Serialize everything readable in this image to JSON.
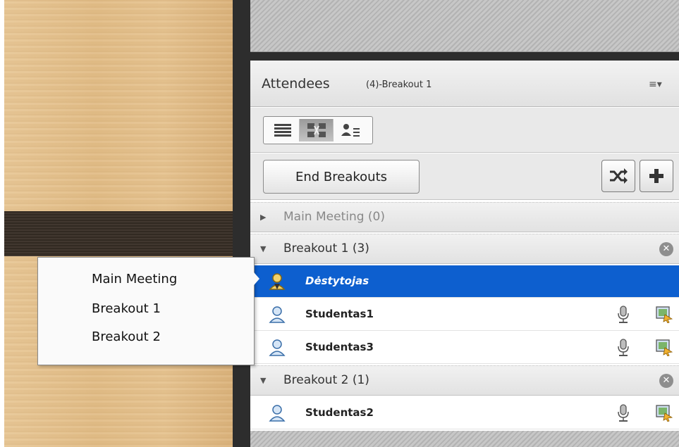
{
  "pod": {
    "title": "Attendees",
    "subtitle": "(4)-Breakout 1",
    "menu_icon": "≡▾"
  },
  "view_buttons": [
    {
      "icon": "list-view-icon",
      "selected": false
    },
    {
      "icon": "breakout-view-icon",
      "selected": true
    },
    {
      "icon": "attendee-detail-icon",
      "selected": false
    }
  ],
  "actions": {
    "end_label": "End Breakouts",
    "shuffle_icon": "shuffle-icon",
    "add_icon": "plus-icon"
  },
  "groups": {
    "main": {
      "label": "Main Meeting (0)",
      "triangle": "▶"
    },
    "breakout1": {
      "label": "Breakout 1 (3)",
      "triangle": "▼",
      "close": "✕"
    },
    "breakout2": {
      "label": "Breakout 2 (1)",
      "triangle": "▼",
      "close": "✕"
    }
  },
  "attendees": [
    {
      "name": "Dėstytojas",
      "role": "host",
      "selected": true
    },
    {
      "name": "Studentas1",
      "role": "participant",
      "selected": false
    },
    {
      "name": "Studentas3",
      "role": "participant",
      "selected": false
    },
    {
      "name": "Studentas2",
      "role": "participant",
      "selected": false
    }
  ],
  "context_menu": {
    "items": [
      "Main Meeting",
      "Breakout 1",
      "Breakout 2"
    ]
  },
  "colors": {
    "selection": "#0d5fcf",
    "frame": "#2d2d2d",
    "wood": "#e4c08b"
  }
}
